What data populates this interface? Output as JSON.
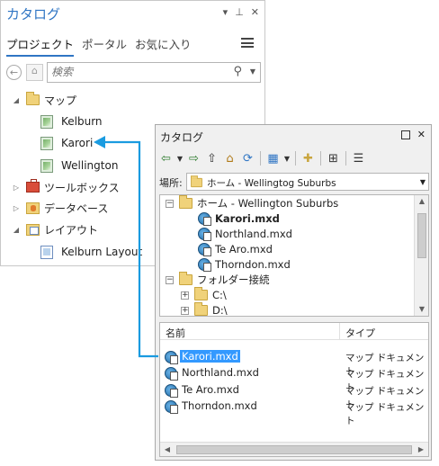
{
  "pro_pane": {
    "title": "カタログ",
    "tabs": [
      {
        "label": "プロジェクト",
        "active": true
      },
      {
        "label": "ポータル",
        "active": false
      },
      {
        "label": "お気に入り",
        "active": false
      }
    ],
    "search_placeholder": "検索",
    "tree": {
      "maps": {
        "label": "マップ",
        "items": [
          "Kelburn",
          "Karori",
          "Wellington"
        ]
      },
      "toolbox": "ツールボックス",
      "database": "データベース",
      "layouts": {
        "label": "レイアウト",
        "items": [
          "Kelburn Layout"
        ]
      }
    }
  },
  "catalog_window": {
    "title": "カタログ",
    "location_label": "場所:",
    "location_value": "ホーム - Wellingtog Suburbs",
    "tree": {
      "home": "ホーム - Wellington Suburbs",
      "documents": [
        "Karori.mxd",
        "Northland.mxd",
        "Te Aro.mxd",
        "Thorndon.mxd"
      ],
      "folder_connections": "フォルダー接続",
      "drives": [
        "C:\\",
        "D:\\"
      ]
    },
    "list": {
      "col_name": "名前",
      "col_type": "タイプ",
      "rows": [
        {
          "name": "Karori.mxd",
          "type": "マップ ドキュメント",
          "selected": true
        },
        {
          "name": "Northland.mxd",
          "type": "マップ ドキュメント",
          "selected": false
        },
        {
          "name": "Te Aro.mxd",
          "type": "マップ ドキュメント",
          "selected": false
        },
        {
          "name": "Thorndon.mxd",
          "type": "マップ ドキュメント",
          "selected": false
        }
      ]
    }
  },
  "colors": {
    "accent": "#2f75c4",
    "arrow": "#1a9be0",
    "selection": "#3399ff"
  }
}
